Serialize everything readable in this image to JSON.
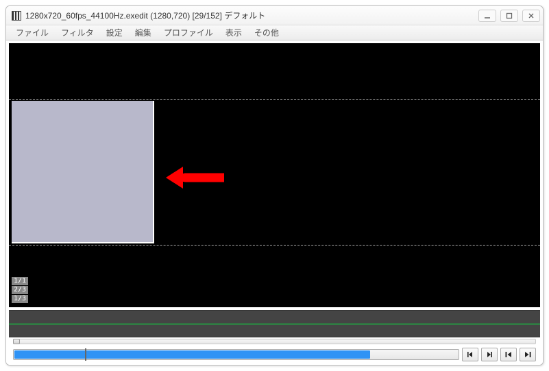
{
  "title": "1280x720_60fps_44100Hz.exedit (1280,720)  [29/152]  デフォルト",
  "menu": {
    "file": "ファイル",
    "filter": "フィルタ",
    "settings": "設定",
    "edit": "編集",
    "profile": "プロファイル",
    "view": "表示",
    "other": "その他"
  },
  "badges": {
    "b1": "1/1",
    "b2": "2/3",
    "b3": "1/3"
  },
  "seek": {
    "fill_percent": 80,
    "tick_percent": 16
  },
  "colors": {
    "square": "#b8b8cb",
    "timeline_marker": "#00ff40",
    "seek_fill": "#2f93f5",
    "arrow": "#ff0000"
  },
  "icons": {
    "minimize": "minimize-icon",
    "maximize": "maximize-icon",
    "close": "close-icon",
    "prev_frame": "prev-frame-icon",
    "next_frame": "next-frame-icon",
    "go_start": "go-start-icon",
    "go_end": "go-end-icon"
  }
}
